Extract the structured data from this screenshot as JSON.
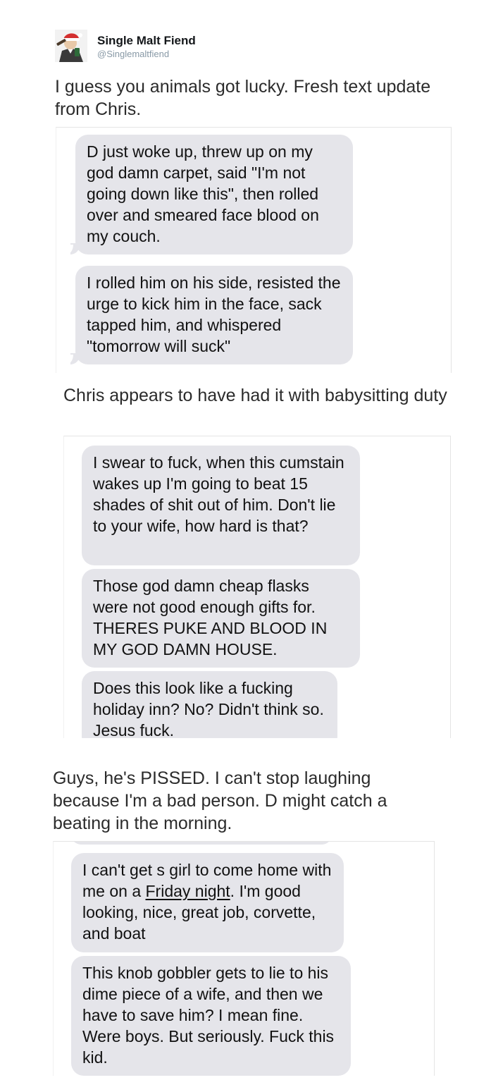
{
  "author": {
    "display_name": "Single Malt Fiend",
    "handle": "@Singlemaltfiend",
    "avatar_icon": "cartoon-avatar-with-santa-hat-icon"
  },
  "captions": [
    "I guess you animals got lucky. Fresh text update from Chris.",
    "Chris appears to have had it with babysitting duty",
    "Guys, he's PISSED.  I can't stop laughing because I'm a bad person. D might catch a beating in the morning."
  ],
  "screenshots": [
    {
      "messages": [
        "D just woke up, threw up on my god damn carpet, said \"I'm not going down like this\", then rolled over and smeared face blood on my couch.",
        "I rolled him on his side, resisted the urge to kick him in the face, sack tapped him, and whispered \"tomorrow will suck\""
      ]
    },
    {
      "messages": [
        "I swear to fuck, when this cumstain wakes up I'm going to beat 15 shades of shit out of him. Don't lie to your wife, how hard is that?",
        "Those god damn cheap flasks were not good enough gifts for. THERES PUKE AND BLOOD IN MY GOD DAMN HOUSE.",
        "Does this look like a fucking holiday inn? No? Didn't think so. Jesus fuck."
      ]
    },
    {
      "messages": [
        {
          "before": "I can't get s girl to come home with me on a ",
          "link": "Friday night",
          "after": ". I'm good looking, nice, great job, corvette, and boat"
        },
        "This knob gobbler gets to lie to his dime piece of a wife, and then we have to save him? I mean fine. Were boys. But seriously. Fuck this kid."
      ]
    }
  ],
  "colors": {
    "bubble_gray": "#e5e5ea",
    "handle_gray": "#8899a6",
    "text": "#14171a"
  }
}
